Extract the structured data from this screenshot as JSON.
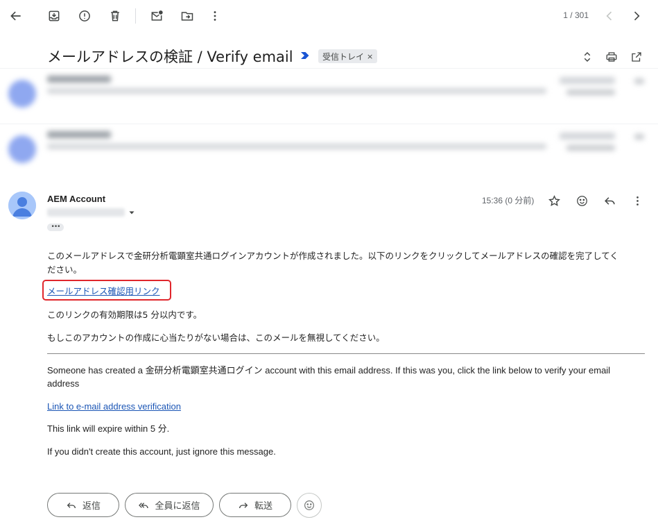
{
  "toolbar": {
    "pager": "1 / 301"
  },
  "subject": {
    "title": "メールアドレスの検証 / Verify email",
    "label": "受信トレイ",
    "label_remove": "×"
  },
  "message": {
    "sender": "AEM Account",
    "time": "15:36 (0 分前)",
    "more_dots": "•••"
  },
  "body": {
    "ja_paragraph_1": "このメールアドレスで金研分析電顕室共通ログインアカウントが作成されました。以下のリンクをクリックしてメールアドレスの確認を完了してく",
    "ja_paragraph_1b": "ださい。",
    "ja_link": "メールアドレス確認用リンク",
    "ja_expiry": "このリンクの有効期限は5 分以内です。",
    "ja_ignore": "もしこのアカウントの作成に心当たりがない場合は、このメールを無視してください。",
    "en_paragraph_1": "Someone has created a 金研分析電顕室共通ログイン account with this email address. If this was you, click the link below to verify your email address",
    "en_link": "Link to e-mail address verification",
    "en_expiry": "This link will expire within 5 分.",
    "en_ignore": "If you didn't create this account, just ignore this message."
  },
  "actions": {
    "reply": "返信",
    "reply_all": "全員に返信",
    "forward": "転送"
  },
  "colors": {
    "link": "#1a55b5",
    "highlight_box": "#e0262c",
    "importance_marker": "#1a55d4"
  }
}
